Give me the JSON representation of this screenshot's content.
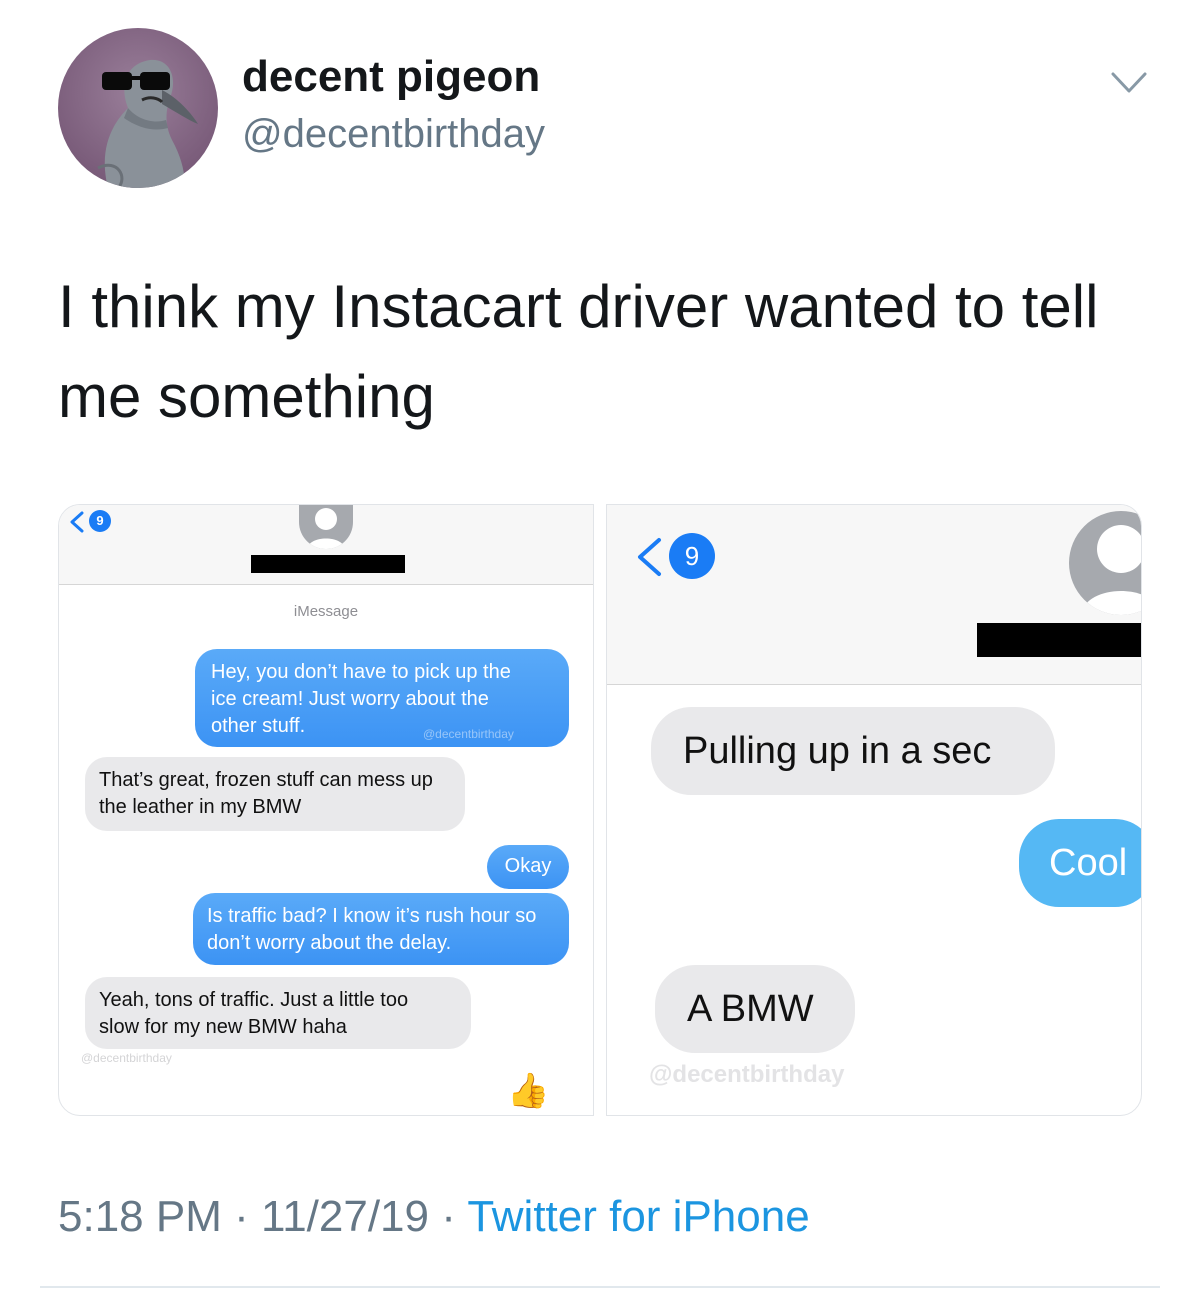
{
  "profile": {
    "name": "decent pigeon",
    "handle": "@decentbirthday",
    "avatar_icon": "pigeon-sunglasses-avatar",
    "menu_icon": "chevron-down-icon"
  },
  "tweet": {
    "text": "I think my Instacart driver wanted to tell me something"
  },
  "screenshot_left": {
    "back_badge": "9",
    "service_label": "iMessage",
    "messages": [
      {
        "dir": "out",
        "text": "Hey, you don’t have to pick up the ice cream! Just worry about the other stuff."
      },
      {
        "dir": "in",
        "text": "That’s great, frozen stuff can mess up the leather in my BMW"
      },
      {
        "dir": "out",
        "text": "Okay"
      },
      {
        "dir": "out",
        "text": "Is traffic bad? I know it’s rush hour so don’t worry about the delay."
      },
      {
        "dir": "in",
        "text": "Yeah, tons of traffic. Just a little too slow for my new BMW haha"
      }
    ],
    "watermark": "@decentbirthday",
    "reaction_emoji": "👍"
  },
  "screenshot_right": {
    "back_badge": "9",
    "messages": [
      {
        "dir": "in",
        "text": "Pulling up in a sec"
      },
      {
        "dir": "out",
        "text": "Cool"
      },
      {
        "dir": "in",
        "text": "A BMW"
      }
    ],
    "watermark": "@decentbirthday"
  },
  "meta": {
    "time": "5:18 PM",
    "sep1": " · ",
    "date": "11/27/19",
    "sep2": " · ",
    "source": "Twitter for iPhone"
  },
  "colors": {
    "accent_link": "#1b95e0",
    "imessage_blue": "#3c93f4",
    "incoming_grey": "#e9e9eb"
  }
}
